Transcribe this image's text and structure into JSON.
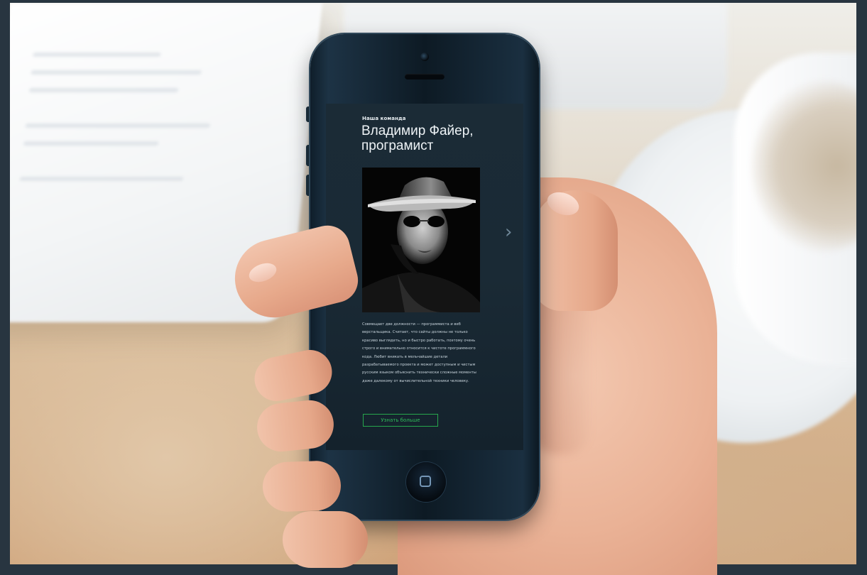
{
  "screen": {
    "section_label": "Наша команда",
    "person_title": "Владимир Файер, програмист",
    "description": "Совмещает две должности — программиста и веб верстальщика. Считает, что сайты должны не только красиво выглядеть, но и быстро работать, поэтому очень строго и внимательно относится к чистоте программного кода. Любит вникать в мельчайшие детали разрабатываемого проекта и может доступным и чистым русским языком объяснить технически сложные моменты даже далекому от вычислительной техники человеку.",
    "more_button": "Узнать больше",
    "prev_arrow": "‹",
    "next_arrow": "›",
    "photo_icon": "person-portrait-hat-sunglasses"
  },
  "colors": {
    "screen_bg": "#1b2b36",
    "accent": "#2fbd5a",
    "text": "#eef3f6"
  }
}
